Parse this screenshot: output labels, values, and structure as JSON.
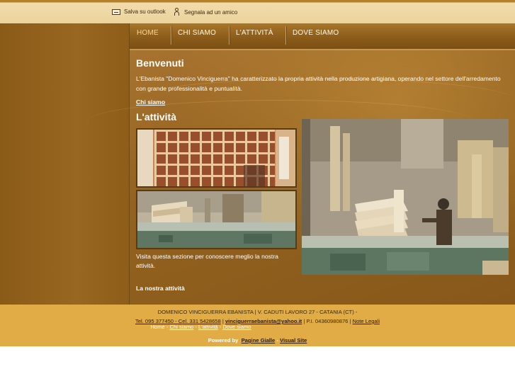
{
  "toolbar": {
    "outlook_label": "Salva su outlook",
    "outlook_icon": "email-card-icon",
    "friend_label": "Segnala ad un amico",
    "friend_icon": "person-icon"
  },
  "nav": {
    "items": [
      {
        "label": "HOME",
        "active": true
      },
      {
        "label": "CHI SIAMO",
        "active": false
      },
      {
        "label": "L'ATTIVITÀ",
        "active": false
      },
      {
        "label": "DOVE SIAMO",
        "active": false
      }
    ]
  },
  "content": {
    "welcome_title": "Benvenuti",
    "intro_text": "L'Ebanista \"Domenico Vinciguerra\" ha caratterizzato la propria attività nella produzione artigiana, operando nel settore dell'arredamento con grande professionalità e puntualità.",
    "chi_siamo_link": "Chi siamo",
    "attivita_title": "L'attività",
    "section_desc": " Visita questa sezione per conoscere meglio la nostra attività.",
    "nostra_attivita_link": "La nostra attività"
  },
  "footer": {
    "company_line": "DOMENICO VINCIGUERRA EBANISTA | V. CADUTI LAVORO 27 - CATANIA (CT) -",
    "phone_link": "Tel. 095 377450 - Cel. 331 5428658",
    "sep1": " | ",
    "email_link": "vinciguerraebanista@yahoo.it",
    "piva_text": " | P.I. 04360980876 | ",
    "legal_link": "Note Legali",
    "nav": [
      "Home",
      "Chi siamo",
      "L'attività",
      "Dove siamo"
    ],
    "nav_sep": " - ",
    "powered_label": "Powered by",
    "powered_link1": "Pagine Gialle",
    "powered_sep": " - ",
    "powered_link2": "Visual Site"
  },
  "colors": {
    "brown_dark": "#8f5f1b",
    "nav_text": "#fff7e6",
    "nav_active": "#f4d79a",
    "footer_bg": "#e1ac45",
    "top_strip": "#ecd39c"
  }
}
